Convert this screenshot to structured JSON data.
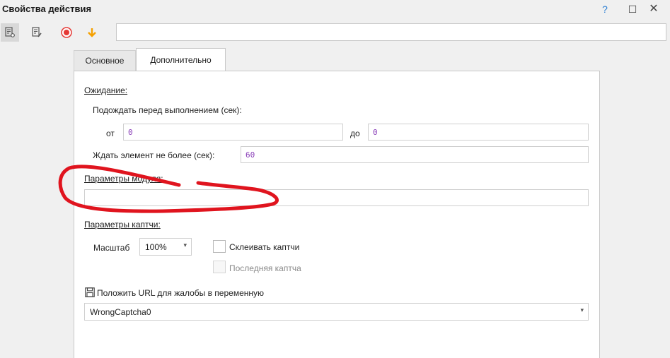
{
  "window": {
    "title": "Свойства действия",
    "help": "?",
    "maximize": "☐",
    "close": "✕"
  },
  "toolbar": {
    "search_value": ""
  },
  "tabs": [
    {
      "label": "Основное"
    },
    {
      "label": "Дополнительно"
    }
  ],
  "wait": {
    "section": "Ожидание:",
    "before_label": "Подождать перед выполнением (сек):",
    "from_label": "от",
    "from_value": "0",
    "to_label": "до",
    "to_value": "0",
    "element_label": "Ждать элемент не более (сек):",
    "element_value": "60"
  },
  "module": {
    "section": "Параметры модуля:",
    "value": ""
  },
  "captcha": {
    "section": "Параметры каптчи:",
    "scale_label": "Масштаб",
    "scale_value": "100%",
    "glue_label": "Склеивать каптчи",
    "last_label": "Последняя каптча"
  },
  "complaint": {
    "label": "Положить URL для жалобы в переменную",
    "value": "WrongCaptcha0"
  },
  "colors": {
    "annotation": "#e0141e",
    "value_text": "#8a3fb8"
  }
}
